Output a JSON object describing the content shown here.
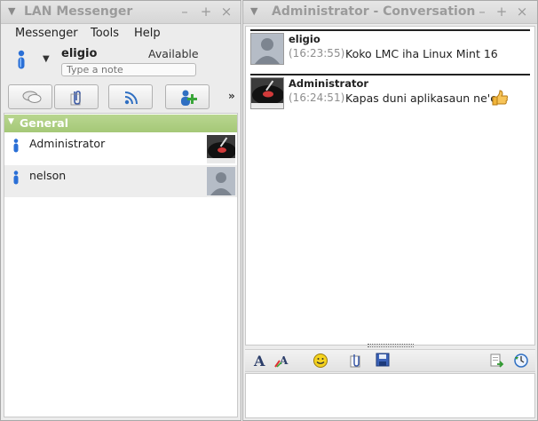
{
  "lan_window": {
    "title": "LAN Messenger",
    "controls": {
      "minimize": "–",
      "maximize": "+",
      "close": "×"
    },
    "menu": [
      "Messenger",
      "Tools",
      "Help"
    ],
    "user": {
      "name": "eligio",
      "status": "Available",
      "note_placeholder": "Type a note"
    },
    "toolbar_overflow": "»",
    "groups": [
      {
        "name": "General",
        "contacts": [
          {
            "name": "Administrator",
            "avatar": "record-player-avatar"
          },
          {
            "name": "nelson",
            "avatar": "default-person-avatar"
          }
        ]
      }
    ]
  },
  "conversation_window": {
    "title": "Administrator - Conversation",
    "controls": {
      "minimize": "–",
      "maximize": "+",
      "close": "×"
    },
    "messages": [
      {
        "sender": "eligio",
        "time": "(16:23:55)",
        "text": "Koko LMC iha Linux Mint 16",
        "avatar": "default-person-avatar"
      },
      {
        "sender": "Administrator",
        "time": "(16:24:51)",
        "text": "Kapas duni aplikasaun ne'e",
        "avatar": "record-player-avatar",
        "emoticon": "thumbs-up"
      }
    ]
  },
  "colors": {
    "group_header": "#a5c877",
    "title_text": "#9b9b9b",
    "timestamp": "#8e8e8e"
  }
}
